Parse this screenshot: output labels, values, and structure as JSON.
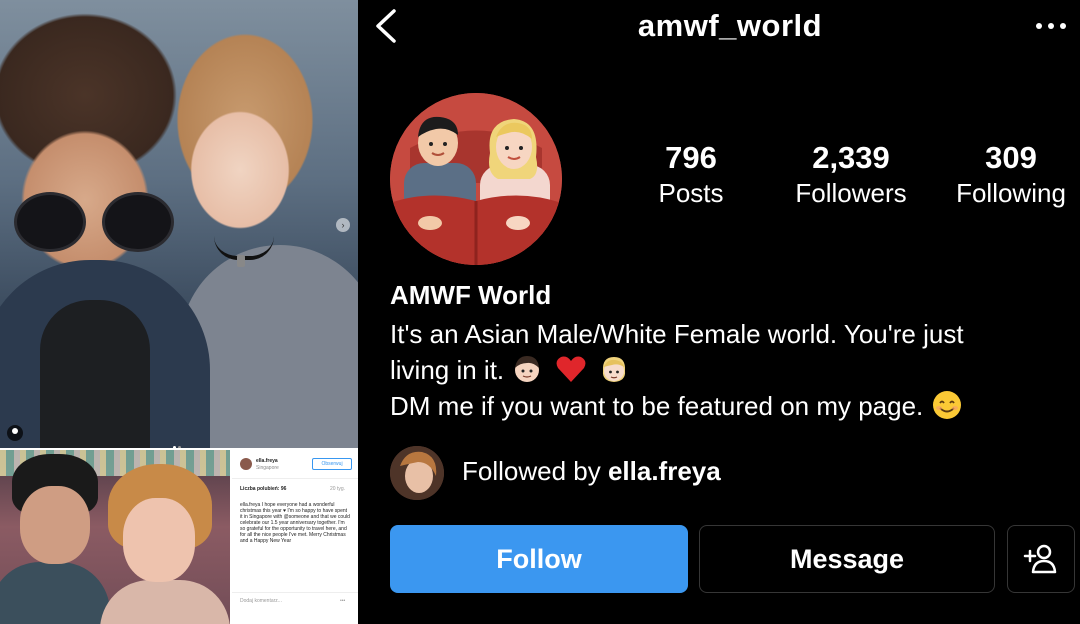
{
  "header": {
    "username": "amwf_world",
    "back_icon": "chevron-left-icon",
    "more_icon": "more-horizontal-icon"
  },
  "stats": [
    {
      "value": "796",
      "label": "Posts"
    },
    {
      "value": "2,339",
      "label": "Followers"
    },
    {
      "value": "309",
      "label": "Following"
    }
  ],
  "profile": {
    "display_name": "AMWF World",
    "bio_line1": "It's an Asian Male/White Female world. You're just",
    "bio_line2": "living in it.",
    "bio_line3": "DM me if you want to be featured on my page.",
    "emojis": [
      "boy-emoji",
      "red-heart-emoji",
      "blonde-woman-emoji",
      "smiling-face-emoji"
    ]
  },
  "followed_by": {
    "prefix": "Followed by",
    "username": "ella.freya"
  },
  "buttons": {
    "follow": "Follow",
    "message": "Message",
    "add_user_icon": "add-person-icon"
  },
  "colors": {
    "follow_blue": "#3b97f0",
    "background": "#000000"
  },
  "embedded_post": {
    "username": "ella.freya",
    "location": "Singapore",
    "follow_label": "Obserwuj",
    "likes": "Liczba polubień: 96",
    "time": "20 tyg.",
    "caption": "ella.freya I hope everyone had a wonderful christmas this year ♥ I'm so happy to have spent it in Singapore with @someone and that we could celebrate our 1.5 year anniversary together. I'm so grateful for the opportunity to travel here, and for all the nice people I've met. Merry Christmas and a Happy New Year",
    "comment_placeholder": "Dodaj komentarz..."
  }
}
